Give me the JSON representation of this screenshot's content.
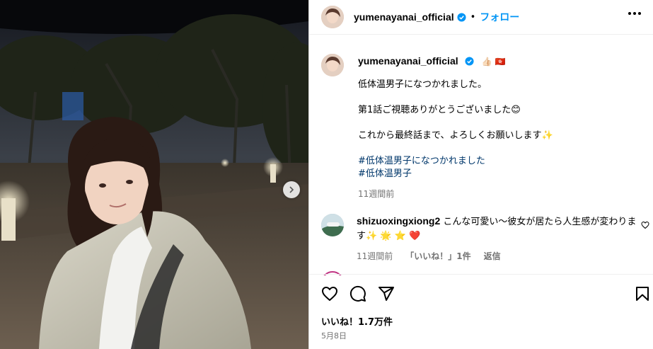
{
  "post": {
    "username": "yumenayanai_official",
    "follow_label": "フォロー",
    "dot": "•",
    "caption": {
      "emoji": "👍🏻 🇭🇰",
      "lines": [
        "低体温男子になつかれました。",
        "第1話ご視聴ありがとうございました😊",
        "これから最終話まで、よろしくお願いします✨"
      ],
      "hashtags": [
        "#低体温男子になつかれました",
        "#低体温男子"
      ],
      "time": "11週間前"
    },
    "comment": {
      "username": "shizuoxingxiong2",
      "text": "こんな可愛い〜彼女が居たら人生感が変わります✨ 🌟 ⭐ ❤️",
      "time": "11週間前",
      "likes": "「いいね！」1件",
      "reply": "返信"
    },
    "likes": "いいね！1.7万件",
    "date": "5月8日"
  },
  "icons": {
    "verified": "verified-badge-icon",
    "more": "more-options-icon",
    "next": "chevron-right-icon",
    "like": "heart-icon",
    "comment": "comment-icon",
    "share": "share-icon",
    "save": "bookmark-icon"
  },
  "colors": {
    "accent": "#0095f6",
    "hashtag": "#00376b",
    "secondary_text": "#737373",
    "verified": "#0095f6"
  }
}
